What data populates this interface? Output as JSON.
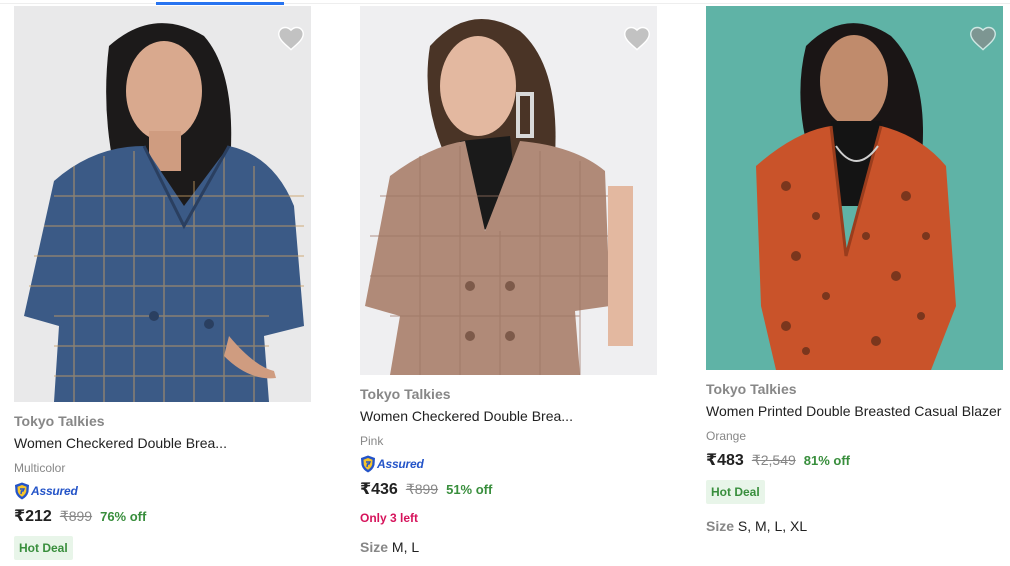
{
  "products": [
    {
      "brand": "Tokyo Talkies",
      "title": "Women Checkered Double Brea...",
      "color": "Multicolor",
      "assured": "Assured",
      "price": "₹212",
      "mrp": "₹899",
      "discount": "76% off",
      "deal": "Hot Deal",
      "photo_bg": "#e9e9ea",
      "garment_color": "#3b5a86"
    },
    {
      "brand": "Tokyo Talkies",
      "title": "Women Checkered Double Brea...",
      "color": "Pink",
      "assured": "Assured",
      "price": "₹436",
      "mrp": "₹899",
      "discount": "51% off",
      "stock": "Only 3 left",
      "size_label": "Size",
      "sizes": "M, L",
      "photo_bg": "#efeff1",
      "garment_color": "#b08a78"
    },
    {
      "brand": "Tokyo Talkies",
      "title": "Women Printed Double Breasted Casual Blazer",
      "color": "Orange",
      "price": "₹483",
      "mrp": "₹2,549",
      "discount": "81% off",
      "deal": "Hot Deal",
      "size_label": "Size",
      "sizes": "S, M, L, XL",
      "photo_bg": "#5fb3a6",
      "garment_color": "#c9532a"
    }
  ],
  "colors": {
    "accent": "#2874f0",
    "discount_green": "#388e3c",
    "deal_bg": "#e8f5e9",
    "stock_pink": "#d6135b",
    "muted": "#878787"
  },
  "icons": {
    "wishlist": "heart-icon",
    "assured": "flipkart-assured-shield-icon"
  }
}
